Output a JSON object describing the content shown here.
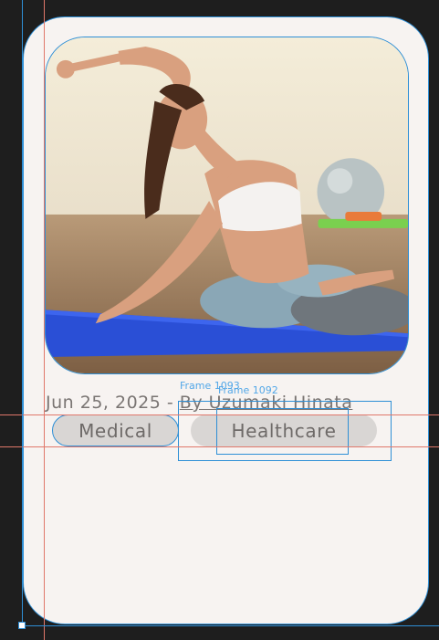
{
  "card": {
    "date": "Jun 25, 2025",
    "separator": "-",
    "author": "By Uzumaki Hinata",
    "tags": [
      {
        "label": "Medical"
      },
      {
        "label": "Healthcare"
      }
    ],
    "image_alt": "woman doing a side stretch yoga pose on a blue mat"
  },
  "editor": {
    "frame_labels": [
      "Frame 1093",
      "Frame 1092"
    ]
  },
  "colors": {
    "selection": "#2e8fd6",
    "guide": "#e0776a",
    "card_bg": "#f7f3f1",
    "tag_bg": "#d9d6d4"
  }
}
